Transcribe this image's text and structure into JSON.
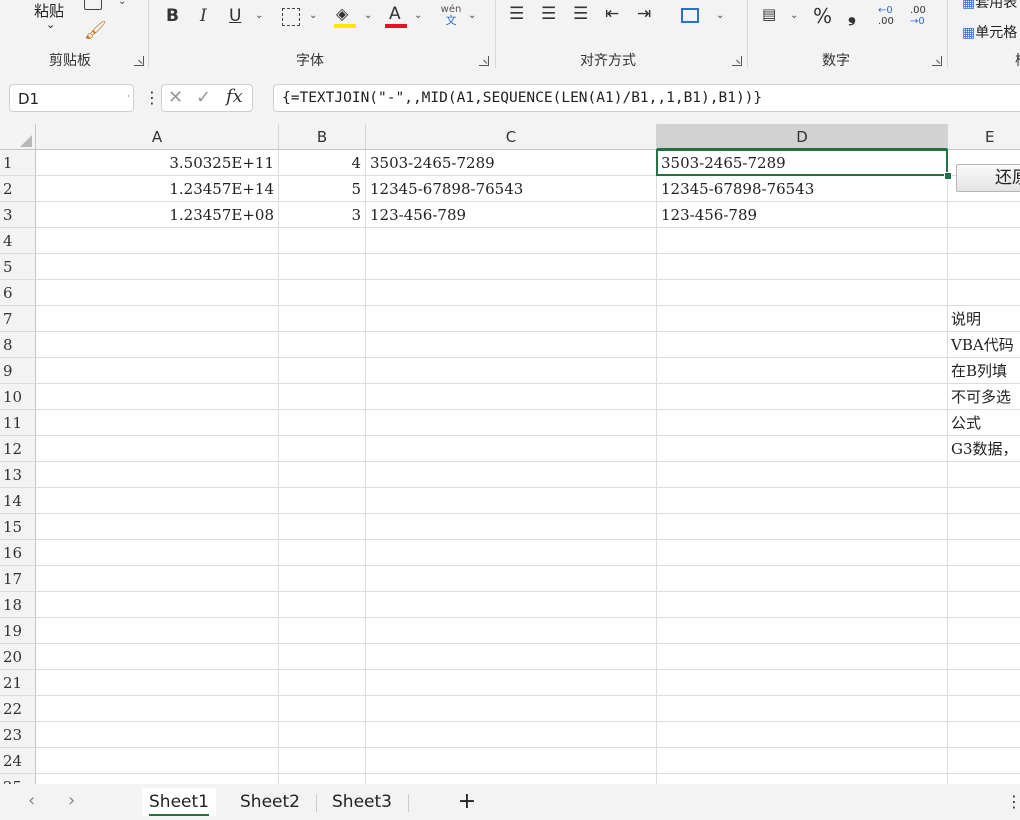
{
  "ribbon": {
    "clipboard": {
      "paste_label": "粘贴",
      "group_label": "剪贴板"
    },
    "font": {
      "group_label": "字体",
      "bold": "B",
      "italic": "I",
      "underline": "U",
      "font_color_glyph": "A",
      "phonetic_top": "wén",
      "phonetic_bottom": "文"
    },
    "alignment": {
      "group_label": "对齐方式"
    },
    "number": {
      "group_label": "数字",
      "percent": "%",
      "comma": "❟",
      "inc_decimal_top": "←0",
      "inc_decimal_bottom": ".00",
      "dec_decimal_top": ".00",
      "dec_decimal_bottom": "→0"
    },
    "styles": {
      "table_format": "套用表",
      "cell_styles": "单元格",
      "group_label_partial": "样"
    }
  },
  "formula_bar": {
    "name_box": "D1",
    "formula": "{=TEXTJOIN(\"-\",,MID(A1,SEQUENCE(LEN(A1)/B1,,1,B1),B1))}"
  },
  "grid": {
    "columns": [
      "A",
      "B",
      "C",
      "D",
      "E"
    ],
    "rows": [
      "1",
      "2",
      "3",
      "4",
      "5",
      "6",
      "7",
      "8",
      "9",
      "10",
      "11",
      "12",
      "13",
      "14",
      "15",
      "16",
      "17",
      "18",
      "19",
      "20",
      "21",
      "22",
      "23",
      "24",
      "25"
    ],
    "cells": {
      "A1": "3.50325E+11",
      "B1": "4",
      "C1": "3503-2465-7289",
      "D1": "3503-2465-7289",
      "A2": "1.23457E+14",
      "B2": "5",
      "C2": "12345-67898-76543",
      "D2": "12345-67898-76543",
      "A3": "1.23457E+08",
      "B3": "3",
      "C3": "123-456-789",
      "D3": "123-456-789",
      "E7": "说明",
      "E8": "VBA代码",
      "E9": "在B列填",
      "E10": "不可多选",
      "E11": "公式",
      "E12": "G3数据，"
    },
    "button_label": "还原",
    "active_cell": "D1"
  },
  "sheets": {
    "tabs": [
      "Sheet1",
      "Sheet2",
      "Sheet3"
    ],
    "active": "Sheet1",
    "add_label": "+"
  },
  "colors": {
    "accent_green": "#217346",
    "font_red": "#e81123",
    "highlight_yellow": "#ffe600"
  }
}
